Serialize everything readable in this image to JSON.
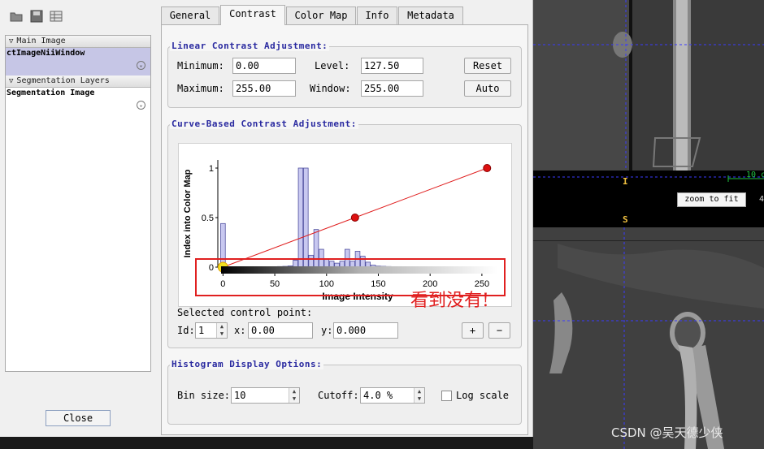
{
  "tabs": [
    "General",
    "Contrast",
    "Color Map",
    "Info",
    "Metadata"
  ],
  "active_tab": "Contrast",
  "left_panel": {
    "main_image_header": "Main Image",
    "main_image_value": "ctImageNiiWindow",
    "seg_header": "Segmentation Layers",
    "seg_value": "Segmentation Image"
  },
  "close_label": "Close",
  "linear": {
    "title": "Linear Contrast Adjustment:",
    "min_label": "Minimum:",
    "min_value": "0.00",
    "max_label": "Maximum:",
    "max_value": "255.00",
    "level_label": "Level:",
    "level_value": "127.50",
    "window_label": "Window:",
    "window_value": "255.00",
    "reset_label": "Reset",
    "auto_label": "Auto"
  },
  "curve": {
    "title": "Curve-Based Contrast Adjustment:",
    "selected_label": "Selected control point:",
    "id_label": "Id:",
    "id_value": "1",
    "x_label": "x:",
    "x_value": "0.00",
    "y_label": "y:",
    "y_value": "0.000",
    "add_label": "+",
    "remove_label": "−"
  },
  "histogram_opts": {
    "title": "Histogram Display Options:",
    "bin_label": "Bin size:",
    "bin_value": "10",
    "cutoff_label": "Cutoff:",
    "cutoff_value": "4.0 %",
    "log_label": "Log scale"
  },
  "annotation": "看到没有!",
  "viewer": {
    "zoom_label": "zoom to fit",
    "orient_top": "I",
    "orient_bottom": "S",
    "scale_top": "10 c",
    "scale_partial": "4"
  },
  "watermark": "CSDN @吴天德少侠",
  "chart_data": {
    "type": "bar",
    "xlabel": "Image Intensity",
    "ylabel": "Index into Color Map",
    "xlim": [
      -5,
      265
    ],
    "ylim": [
      0,
      1.0
    ],
    "xticks": [
      0,
      50,
      100,
      150,
      200,
      250
    ],
    "yticks": [
      0,
      0.5,
      1
    ],
    "ytick_labels": [
      "0",
      "0.5",
      "1"
    ],
    "histogram": {
      "x": [
        0,
        30,
        35,
        40,
        45,
        50,
        55,
        60,
        65,
        70,
        75,
        80,
        85,
        90,
        95,
        100,
        105,
        110,
        115,
        120,
        125,
        130,
        135,
        140,
        145,
        150,
        155,
        160,
        165,
        170,
        175,
        180,
        185,
        190,
        195,
        200,
        205,
        210,
        215,
        220,
        225,
        230,
        235,
        240,
        245,
        250,
        255
      ],
      "y": [
        0.44,
        0.003,
        0.003,
        0.004,
        0.004,
        0.005,
        0.006,
        0.008,
        0.012,
        0.07,
        1.0,
        1.0,
        0.12,
        0.38,
        0.18,
        0.08,
        0.06,
        0.04,
        0.06,
        0.18,
        0.06,
        0.16,
        0.11,
        0.05,
        0.02,
        0.01,
        0.008,
        0.006,
        0.005,
        0.005,
        0.004,
        0.004,
        0.004,
        0.003,
        0.003,
        0.003,
        0.003,
        0.003,
        0.003,
        0.003,
        0.003,
        0.003,
        0.003,
        0.003,
        0.003,
        0.003,
        0.003
      ]
    },
    "curve": {
      "x": [
        0,
        127.5,
        255
      ],
      "y": [
        0,
        0.5,
        1
      ]
    },
    "control_points": [
      {
        "x": 0,
        "y": 0,
        "color": "#f0e020"
      },
      {
        "x": 127.5,
        "y": 0.5,
        "color": "#dd1010"
      },
      {
        "x": 255,
        "y": 1,
        "color": "#dd1010"
      }
    ],
    "bar_color": "#c8c8f0",
    "bar_edge": "#5050a0",
    "line_color": "#e02020"
  }
}
